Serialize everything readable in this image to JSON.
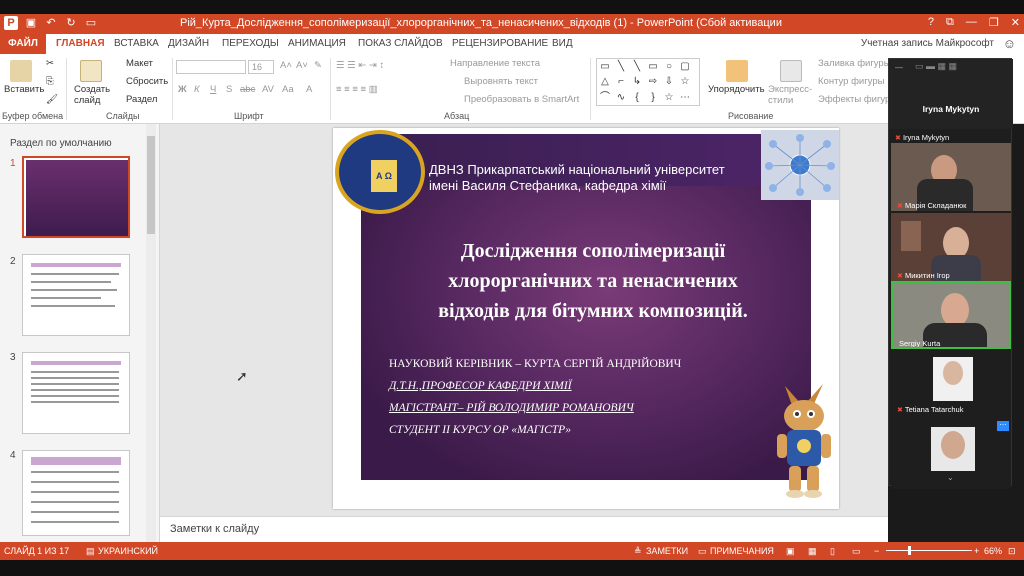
{
  "window": {
    "title": "Рій_Курта_Дослідження_сополімеризації_хлорорганічних_та_ненасичених_відходів (1)  -  PowerPoint (Сбой активации продукта)",
    "controls": [
      "?",
      "⧉",
      "—",
      "❐",
      "✕"
    ]
  },
  "tabs": {
    "file": "ФАЙЛ",
    "items": [
      "ГЛАВНАЯ",
      "ВСТАВКА",
      "ДИЗАЙН",
      "ПЕРЕХОДЫ",
      "АНИМАЦИЯ",
      "ПОКАЗ СЛАЙДОВ",
      "РЕЦЕНЗИРОВАНИЕ",
      "ВИД"
    ],
    "active": "ГЛАВНАЯ",
    "account": "Учетная запись Майкрософт"
  },
  "ribbon": {
    "paste": "Вставить",
    "clipboard_group": "Буфер обмена",
    "create_slide": "Создать слайд",
    "layout": "Макет",
    "reset": "Сбросить",
    "section": "Раздел",
    "slides_group": "Слайды",
    "font_size": "16",
    "font_group": "Шрифт",
    "text_direction": "Направление текста",
    "align_text": "Выровнять текст",
    "smartart": "Преобразовать в SmartArt",
    "paragraph_group": "Абзац",
    "arrange": "Упорядочить",
    "quick_styles": "Экспресс-стили",
    "shape_fill": "Заливка фигуры",
    "shape_outline": "Контур фигуры",
    "shape_effects": "Эффекты фигуры",
    "drawing_group": "Рисование",
    "font_buttons": [
      "Ж",
      "К",
      "Ч",
      "S",
      "abc",
      "AV",
      "Aa",
      "A"
    ]
  },
  "leftpanel": {
    "section": "Раздел по умолчанию",
    "slides": [
      "1",
      "2",
      "3",
      "4"
    ]
  },
  "slide": {
    "university": "ДВНЗ Прикарпатський національний університет",
    "university2": "імені Василя Стефаника, кафедра хімії",
    "seal_text": "A Ω",
    "title1": "Дослідження сополімеризації",
    "title2": "хлорорганічних та ненасичених",
    "title3": "відходів для бітумних композицій.",
    "line1": "НАУКОВИЙ КЕРІВНИК – КУРТА СЕРГІЙ АНДРІЙОВИЧ",
    "line2": "Д.Т.Н.,ПРОФЕСОР КАФЕДРИ ХІМІЇ",
    "line3": "МАГІСТРАНТ– РІЙ ВОЛОДИМИР РОМАНОВИЧ",
    "line4": "СТУДЕНТ ІІ КУРСУ ОР «МАГІСТР»"
  },
  "notes": "Заметки к слайду",
  "zoom": {
    "host": "Iryna Mykytyn",
    "participants": [
      "Iryna Mykytyn",
      "Марія Складанюк",
      "Микитин Ігор",
      "Sergiy Kurta",
      "Tetiana Tatarchuk"
    ]
  },
  "status": {
    "slide": "СЛАЙД 1 ИЗ 17",
    "language": "УКРАИНСКИЙ",
    "notes": "ЗАМЕТКИ",
    "comments": "ПРИМЕЧАНИЯ",
    "zoom": "66%"
  },
  "colors": {
    "accent": "#d24726",
    "slide_bg": "#5a2a63"
  }
}
